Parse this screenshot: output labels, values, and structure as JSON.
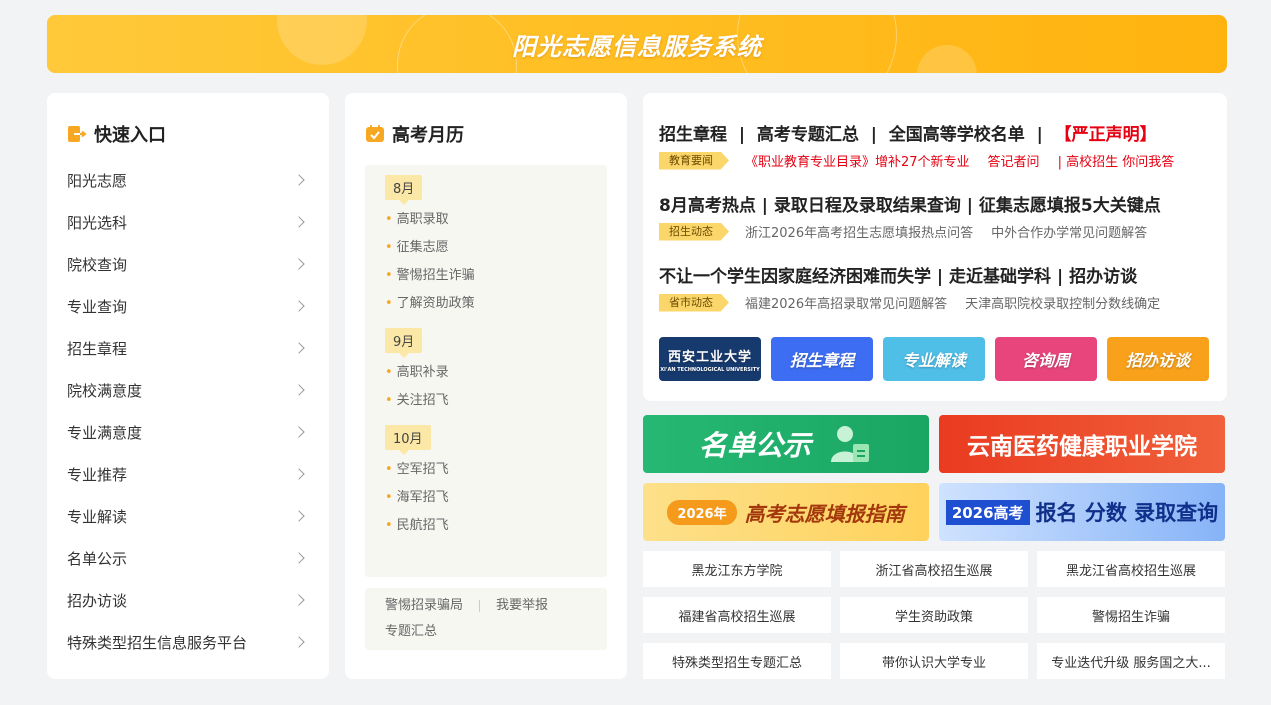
{
  "banner": {
    "title": "阳光志愿信息服务系统"
  },
  "quick": {
    "title": "快速入口",
    "items": [
      "阳光志愿",
      "阳光选科",
      "院校查询",
      "专业查询",
      "招生章程",
      "院校满意度",
      "专业满意度",
      "专业推荐",
      "专业解读",
      "名单公示",
      "招办访谈",
      "特殊类型招生信息服务平台"
    ]
  },
  "calendar": {
    "title": "高考月历",
    "months": [
      {
        "label": "8月",
        "items": [
          "高职录取",
          "征集志愿",
          "警惕招生诈骗",
          "了解资助政策"
        ]
      },
      {
        "label": "9月",
        "items": [
          "高职补录",
          "关注招飞"
        ]
      },
      {
        "label": "10月",
        "items": [
          "空军招飞",
          "海军招飞",
          "民航招飞"
        ]
      }
    ],
    "footer": {
      "link1": "警惕招录骗局",
      "link2": "我要举报",
      "link3": "专题汇总"
    }
  },
  "news": {
    "row1": {
      "h1": "招生章程",
      "h2": "高考专题汇总",
      "h3": "全国高等学校名单",
      "h4": "【严正声明】",
      "tag": "教育要闻",
      "l1": "《职业教育专业目录》增补27个新专业",
      "l2": "答记者问",
      "l3": "| 高校招生 你问我答"
    },
    "row2": {
      "headline": "8月高考热点 | 录取日程及录取结果查询 | 征集志愿填报5大关键点",
      "tag": "招生动态",
      "l1": "浙江2026年高考招生志愿填报热点问答",
      "l2": "中外合作办学常见问题解答"
    },
    "row3": {
      "headline": "不让一个学生因家庭经济困难而失学 | 走近基础学科 | 招办访谈",
      "tag": "省市动态",
      "l1": "福建2026年高招录取常见问题解答",
      "l2": "天津高职院校录取控制分数线确定"
    },
    "tiles": {
      "univ": "西安工业大学",
      "univ_en": "XI'AN TECHNOLOGICAL UNIVERSITY",
      "t2": "招生章程",
      "t3": "专业解读",
      "t4": "咨询周",
      "t5": "招办访谈"
    },
    "colors": {
      "t2": "#3d6df2",
      "t3": "#4fbfe8",
      "t4": "#e8457d",
      "t5": "#f9a11b"
    }
  },
  "promos": {
    "list": "名单公示",
    "yunnan": "云南医药健康职业学院",
    "guide_year": "2026年",
    "guide": "高考志愿填报指南",
    "query_year": "2026高考",
    "query": "报名 分数 录取查询"
  },
  "links": [
    "黑龙江东方学院",
    "浙江省高校招生巡展",
    "黑龙江省高校招生巡展",
    "福建省高校招生巡展",
    "学生资助政策",
    "警惕招生诈骗",
    "特殊类型招生专题汇总",
    "带你认识大学专业",
    "专业迭代升级 服务国之大..."
  ]
}
